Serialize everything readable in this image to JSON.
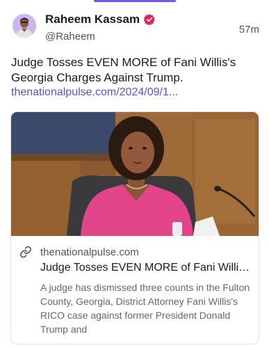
{
  "author": {
    "name": "Raheem Kassam",
    "handle": "@Raheem",
    "verified_icon": "verified-badge-icon",
    "accent_color": "#e0245e"
  },
  "post": {
    "time": "57m",
    "text": "Judge Tosses EVEN MORE of Fani Willis's Georgia Charges Against Trump.",
    "link_text": "thenationalpulse.com/2024/09/1..."
  },
  "card": {
    "domain": "thenationalpulse.com",
    "link_icon": "link-icon",
    "title": "Judge Tosses EVEN MORE of Fani Willis's Georgia Charges Against Trump.",
    "description": "A judge has dismissed three counts in the Fulton County, Georgia, District Attorney Fani Willis's RICO case against former President Donald Trump and"
  },
  "colors": {
    "link": "#5b4fd6",
    "tab_indicator": "#6c5ce7"
  }
}
